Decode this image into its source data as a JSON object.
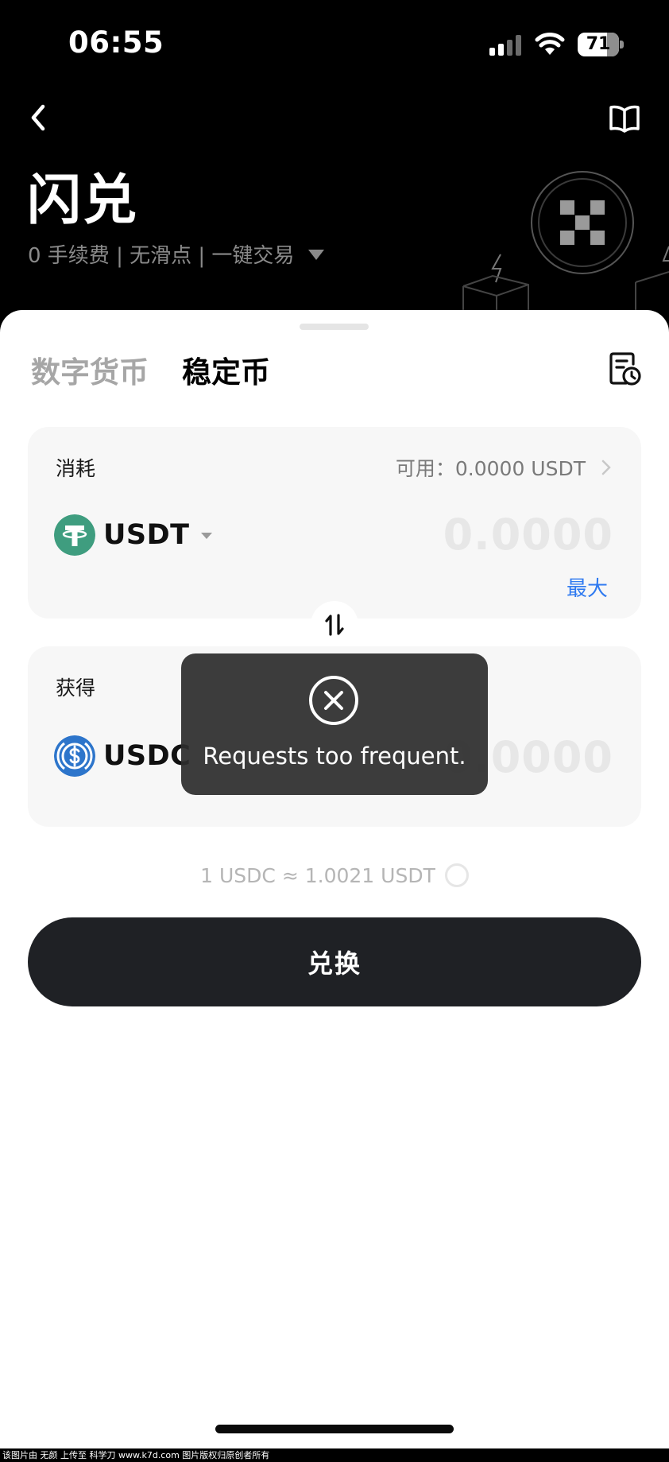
{
  "status_bar": {
    "time": "06:55",
    "battery": "71"
  },
  "header": {
    "title": "闪兑",
    "subtitle": "0 手续费 | 无滑点 | 一键交易"
  },
  "tabs": [
    {
      "label": "数字货币",
      "active": false
    },
    {
      "label": "稳定币",
      "active": true
    }
  ],
  "pay_card": {
    "label": "消耗",
    "available": "可用：0.0000 USDT",
    "token": "USDT",
    "token_color": "#3f9d7f",
    "amount_placeholder": "0.0000",
    "max_label": "最大"
  },
  "receive_card": {
    "label": "获得",
    "token": "USDC",
    "token_color": "#2d75cb",
    "amount_placeholder": "0.0000"
  },
  "rate": "1 USDC ≈ 1.0021 USDT",
  "exchange_button": "兑换",
  "toast": {
    "message": "Requests too frequent."
  },
  "watermark": "该图片由 无颜 上传至 科学刀 www.k7d.com 图片版权归原创者所有",
  "colors": {
    "accent_blue": "#2f7af0",
    "button_dark": "#1f2125"
  }
}
